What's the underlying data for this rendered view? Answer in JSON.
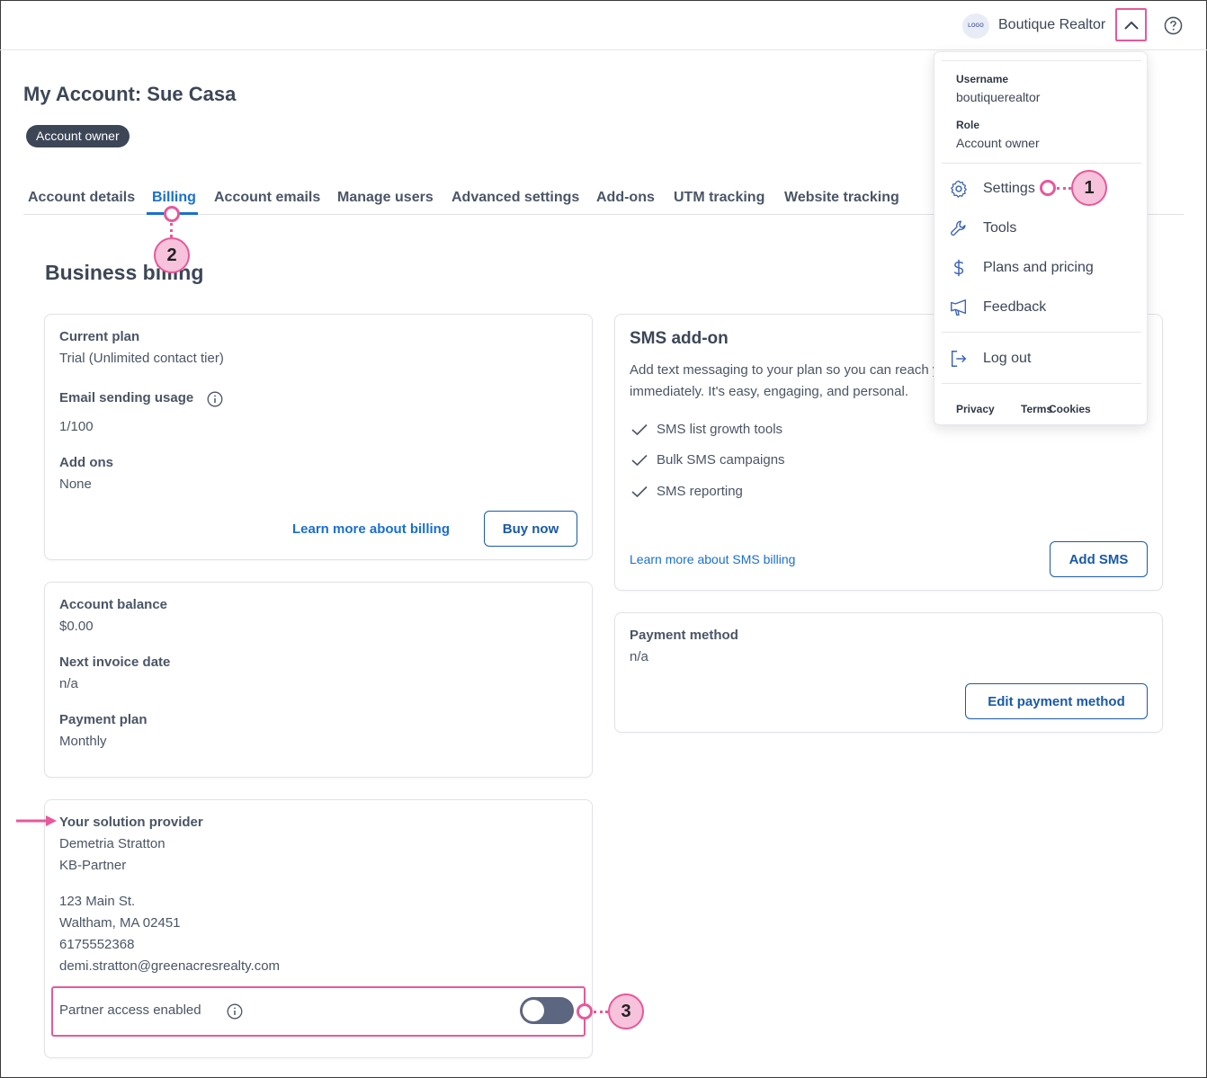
{
  "header": {
    "logo_text": "LOGO",
    "account_name": "Boutique Realtor"
  },
  "page": {
    "title": "My Account: Sue Casa",
    "badge": "Account owner"
  },
  "tabs": [
    {
      "label": "Account details"
    },
    {
      "label": "Billing"
    },
    {
      "label": "Account emails"
    },
    {
      "label": "Manage users"
    },
    {
      "label": "Advanced settings"
    },
    {
      "label": "Add-ons"
    },
    {
      "label": "UTM tracking"
    },
    {
      "label": "Website tracking"
    }
  ],
  "section_title": "Business billing",
  "plan_card": {
    "current_plan_label": "Current plan",
    "current_plan_value": "Trial (Unlimited contact tier)",
    "usage_label": "Email sending usage",
    "usage_value": "1/100",
    "addons_label": "Add ons",
    "addons_value": "None",
    "learn_more": "Learn more about billing",
    "buy_now": "Buy now"
  },
  "balance_card": {
    "balance_label": "Account balance",
    "balance_value": "$0.00",
    "invoice_label": "Next invoice date",
    "invoice_value": "n/a",
    "plan_label": "Payment plan",
    "plan_value": "Monthly"
  },
  "provider_card": {
    "title": "Your solution provider",
    "name": "Demetria Stratton",
    "company": "KB-Partner",
    "street": "123 Main St.",
    "city": "Waltham, MA 02451",
    "phone": "6175552368",
    "email": "demi.stratton@greenacresrealty.com",
    "partner_access_label": "Partner access enabled",
    "partner_access_enabled": true
  },
  "sms_card": {
    "title": "SMS add-on",
    "desc_line1": "Add text messaging to your plan so you can reach your contacts",
    "desc_line2": "immediately. It's easy, engaging, and personal.",
    "features": [
      "SMS list growth tools",
      "Bulk SMS campaigns",
      "SMS reporting"
    ],
    "learn_more": "Learn more about SMS billing",
    "add_sms": "Add SMS"
  },
  "payment_card": {
    "label": "Payment method",
    "value": "n/a",
    "edit_button": "Edit payment method"
  },
  "dropdown": {
    "username_label": "Username",
    "username_value": "boutiquerealtor",
    "role_label": "Role",
    "role_value": "Account owner",
    "items": [
      {
        "label": "Settings",
        "icon": "gear-icon"
      },
      {
        "label": "Tools",
        "icon": "wrench-icon"
      },
      {
        "label": "Plans and pricing",
        "icon": "dollar-icon"
      },
      {
        "label": "Feedback",
        "icon": "megaphone-icon"
      }
    ],
    "logout": "Log out",
    "footer": [
      "Privacy",
      "Terms",
      "Cookies"
    ]
  },
  "callouts": [
    "1",
    "2",
    "3"
  ],
  "colors": {
    "accent": "#1a6fd0",
    "callout": "#e8589a",
    "callout_fill": "#f7c2db",
    "badge": "#3c4657",
    "toggle": "#5d6680"
  }
}
